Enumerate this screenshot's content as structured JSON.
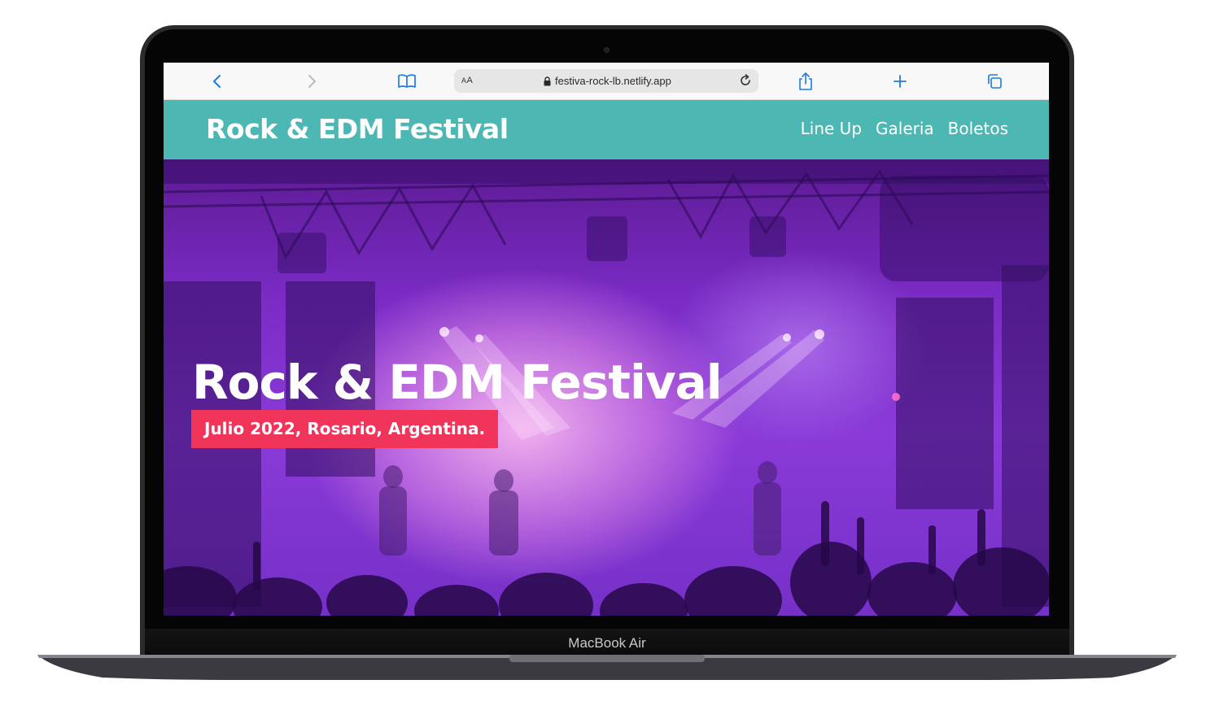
{
  "device": {
    "label": "MacBook Air"
  },
  "browser": {
    "url_text": "festiva-rock-lb.netlify.app",
    "text_size_label": "AA",
    "icons": [
      "chevron-left-icon",
      "chevron-right-icon",
      "book-icon",
      "lock-icon",
      "reload-icon",
      "share-icon",
      "plus-icon",
      "tabs-icon"
    ]
  },
  "site": {
    "brand": "Rock & EDM Festival",
    "nav": [
      "Line Up",
      "Galeria",
      "Boletos"
    ],
    "hero": {
      "title": "Rock & EDM Festival",
      "tagline": "Julio 2022, Rosario, Argentina."
    }
  },
  "colors": {
    "header_bg": "#4db7b3",
    "tag_bg": "#f0345a",
    "link_icon": "#1f7ae0"
  }
}
